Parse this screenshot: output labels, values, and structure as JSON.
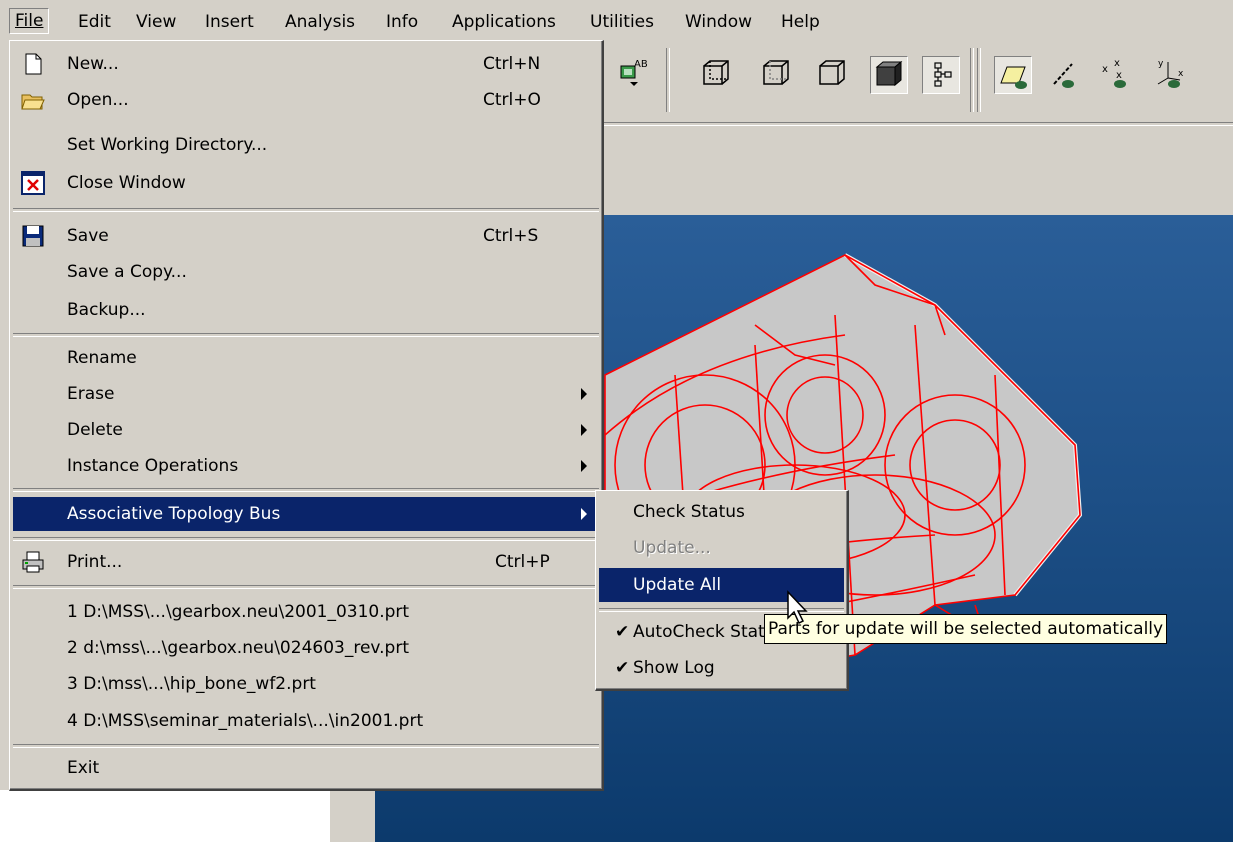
{
  "menubar": {
    "items": [
      "File",
      "Edit",
      "View",
      "Insert",
      "Analysis",
      "Info",
      "Applications",
      "Utilities",
      "Window",
      "Help"
    ]
  },
  "file_menu": {
    "items": [
      {
        "label": "New...",
        "shortcut": "Ctrl+N",
        "icon": "new-document-icon"
      },
      {
        "label": "Open...",
        "shortcut": "Ctrl+O",
        "icon": "open-folder-icon"
      },
      {
        "label": "Set Working Directory..."
      },
      {
        "label": "Close Window",
        "icon": "close-window-icon"
      },
      {
        "label": "Save",
        "shortcut": "Ctrl+S",
        "icon": "floppy-disk-icon"
      },
      {
        "label": "Save a Copy..."
      },
      {
        "label": "Backup..."
      },
      {
        "label": "Rename"
      },
      {
        "label": "Erase"
      },
      {
        "label": "Delete"
      },
      {
        "label": "Instance Operations"
      },
      {
        "label": "Associative Topology Bus"
      },
      {
        "label": "Print...",
        "shortcut": "Ctrl+P",
        "icon": "printer-icon"
      },
      {
        "label": "1 D:\\MSS\\...\\gearbox.neu\\2001_0310.prt"
      },
      {
        "label": "2 d:\\mss\\...\\gearbox.neu\\024603_rev.prt"
      },
      {
        "label": "3 D:\\mss\\...\\hip_bone_wf2.prt"
      },
      {
        "label": "4 D:\\MSS\\seminar_materials\\...\\in2001.prt"
      },
      {
        "label": "Exit"
      }
    ]
  },
  "submenu": {
    "items": [
      {
        "label": "Check Status"
      },
      {
        "label": "Update..."
      },
      {
        "label": "Update All"
      },
      {
        "label": "AutoCheck Status"
      },
      {
        "label": "Show Log"
      }
    ]
  },
  "tooltip": {
    "text": "Parts for update will be selected automatically"
  },
  "colors": {
    "menu_bg": "#d4d0c8",
    "highlight": "#0a246a",
    "viewport": "#1d4f86",
    "wireframe": "#ff0000"
  }
}
